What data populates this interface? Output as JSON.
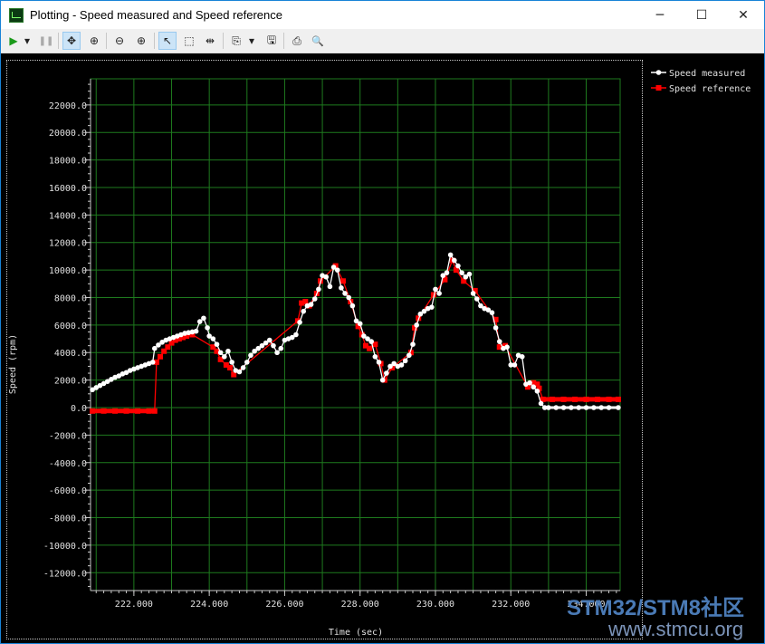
{
  "window": {
    "title": "Plotting  - Speed measured and Speed reference",
    "minimize_glyph": "─",
    "maximize_glyph": "☐",
    "close_glyph": "✕"
  },
  "toolbar": {
    "items": [
      {
        "name": "play-icon",
        "glyph": "▶"
      },
      {
        "name": "play-dropdown-icon",
        "glyph": "▾"
      },
      {
        "name": "pause-icon",
        "glyph": "❚❚"
      },
      {
        "name": "pan-icon",
        "glyph": "✥"
      },
      {
        "name": "zoom-fit-icon",
        "glyph": "⊕"
      },
      {
        "name": "zoom-out-icon",
        "glyph": "⊖"
      },
      {
        "name": "zoom-in-icon",
        "glyph": "⊕"
      },
      {
        "name": "select-pointer-icon",
        "glyph": "↖"
      },
      {
        "name": "select-rectangle-icon",
        "glyph": "⬚"
      },
      {
        "name": "cursor-marker-icon",
        "glyph": "⇹"
      },
      {
        "name": "copy-icon",
        "glyph": "⎘"
      },
      {
        "name": "copy-dropdown-icon",
        "glyph": "▾"
      },
      {
        "name": "save-icon",
        "glyph": "🖫"
      },
      {
        "name": "print-icon",
        "glyph": "⎙"
      },
      {
        "name": "print-preview-icon",
        "glyph": "🔍"
      }
    ]
  },
  "chart_data": {
    "type": "line",
    "title": "",
    "xlabel": "Time (sec)",
    "ylabel": "Speed (rpm)",
    "xlim": [
      220.85,
      234.9
    ],
    "ylim": [
      -13300,
      23900
    ],
    "grid": true,
    "legend_position": "top-right (outside plot)",
    "x_ticks": [
      "222.000",
      "224.000",
      "226.000",
      "228.000",
      "230.000",
      "232.000",
      "234.000"
    ],
    "x_tick_values": [
      222,
      224,
      226,
      228,
      230,
      232,
      234
    ],
    "y_ticks": [
      "22000.0",
      "20000.0",
      "18000.0",
      "16000.0",
      "14000.0",
      "12000.0",
      "10000.0",
      "8000.0",
      "6000.0",
      "4000.0",
      "2000.0",
      "0.0",
      "-2000.0",
      "-4000.0",
      "-6000.0",
      "-8000.0",
      "-10000.0",
      "-12000.0"
    ],
    "y_tick_values": [
      22000,
      20000,
      18000,
      16000,
      14000,
      12000,
      10000,
      8000,
      6000,
      4000,
      2000,
      0,
      -2000,
      -4000,
      -6000,
      -8000,
      -10000,
      -12000
    ],
    "colors": {
      "background": "#000000",
      "grid": "#1e7a1e",
      "axis": "#c8c8c8",
      "text": "#e0e0e0"
    },
    "series": [
      {
        "name": "Speed measured",
        "color": "#ffffff",
        "marker": "circle",
        "points": [
          [
            220.9,
            1300
          ],
          [
            221.0,
            1450
          ],
          [
            221.1,
            1600
          ],
          [
            221.2,
            1750
          ],
          [
            221.3,
            1900
          ],
          [
            221.4,
            2050
          ],
          [
            221.5,
            2200
          ],
          [
            221.6,
            2300
          ],
          [
            221.7,
            2450
          ],
          [
            221.8,
            2550
          ],
          [
            221.9,
            2700
          ],
          [
            222.0,
            2800
          ],
          [
            222.1,
            2900
          ],
          [
            222.2,
            3000
          ],
          [
            222.3,
            3100
          ],
          [
            222.4,
            3200
          ],
          [
            222.5,
            3300
          ],
          [
            222.55,
            4300
          ],
          [
            222.65,
            4550
          ],
          [
            222.75,
            4750
          ],
          [
            222.85,
            4900
          ],
          [
            222.95,
            5000
          ],
          [
            223.05,
            5100
          ],
          [
            223.15,
            5200
          ],
          [
            223.25,
            5300
          ],
          [
            223.35,
            5400
          ],
          [
            223.45,
            5450
          ],
          [
            223.55,
            5500
          ],
          [
            223.65,
            5550
          ],
          [
            223.75,
            6250
          ],
          [
            223.85,
            6500
          ],
          [
            223.95,
            5800
          ],
          [
            224.0,
            5200
          ],
          [
            224.1,
            5000
          ],
          [
            224.2,
            4600
          ],
          [
            224.3,
            4000
          ],
          [
            224.4,
            3700
          ],
          [
            224.5,
            4100
          ],
          [
            224.6,
            3300
          ],
          [
            224.7,
            2700
          ],
          [
            224.8,
            2600
          ],
          [
            224.9,
            2900
          ],
          [
            225.0,
            3300
          ],
          [
            225.1,
            3800
          ],
          [
            225.2,
            4100
          ],
          [
            225.3,
            4300
          ],
          [
            225.4,
            4500
          ],
          [
            225.5,
            4700
          ],
          [
            225.6,
            4900
          ],
          [
            225.7,
            4500
          ],
          [
            225.8,
            4000
          ],
          [
            225.9,
            4300
          ],
          [
            226.0,
            4900
          ],
          [
            226.1,
            5000
          ],
          [
            226.2,
            5100
          ],
          [
            226.3,
            5300
          ],
          [
            226.4,
            6200
          ],
          [
            226.5,
            7000
          ],
          [
            226.6,
            7400
          ],
          [
            226.7,
            7500
          ],
          [
            226.8,
            7900
          ],
          [
            226.9,
            8600
          ],
          [
            227.0,
            9600
          ],
          [
            227.1,
            9500
          ],
          [
            227.2,
            8800
          ],
          [
            227.3,
            10200
          ],
          [
            227.4,
            10000
          ],
          [
            227.5,
            8700
          ],
          [
            227.6,
            8300
          ],
          [
            227.7,
            8000
          ],
          [
            227.8,
            7400
          ],
          [
            227.9,
            6300
          ],
          [
            228.0,
            6100
          ],
          [
            228.1,
            5200
          ],
          [
            228.2,
            5000
          ],
          [
            228.3,
            4800
          ],
          [
            228.4,
            3700
          ],
          [
            228.5,
            3300
          ],
          [
            228.6,
            2000
          ],
          [
            228.7,
            2500
          ],
          [
            228.8,
            3000
          ],
          [
            228.9,
            3200
          ],
          [
            229.0,
            3000
          ],
          [
            229.1,
            3100
          ],
          [
            229.2,
            3400
          ],
          [
            229.3,
            3800
          ],
          [
            229.4,
            4600
          ],
          [
            229.5,
            6000
          ],
          [
            229.6,
            6800
          ],
          [
            229.7,
            7000
          ],
          [
            229.8,
            7200
          ],
          [
            229.9,
            7300
          ],
          [
            230.0,
            8600
          ],
          [
            230.1,
            8300
          ],
          [
            230.2,
            9600
          ],
          [
            230.3,
            9800
          ],
          [
            230.4,
            11100
          ],
          [
            230.5,
            10700
          ],
          [
            230.6,
            10300
          ],
          [
            230.7,
            9800
          ],
          [
            230.8,
            9500
          ],
          [
            230.9,
            9700
          ],
          [
            231.0,
            8300
          ],
          [
            231.1,
            7900
          ],
          [
            231.2,
            7400
          ],
          [
            231.3,
            7200
          ],
          [
            231.4,
            7100
          ],
          [
            231.5,
            6900
          ],
          [
            231.6,
            5800
          ],
          [
            231.7,
            4800
          ],
          [
            231.8,
            4300
          ],
          [
            231.9,
            4400
          ],
          [
            232.0,
            3100
          ],
          [
            232.1,
            3100
          ],
          [
            232.2,
            3800
          ],
          [
            232.3,
            3700
          ],
          [
            232.4,
            1700
          ],
          [
            232.5,
            1800
          ],
          [
            232.6,
            1500
          ],
          [
            232.7,
            1200
          ],
          [
            232.8,
            300
          ],
          [
            232.9,
            0
          ],
          [
            233.0,
            0
          ],
          [
            233.2,
            0
          ],
          [
            233.4,
            0
          ],
          [
            233.6,
            0
          ],
          [
            233.8,
            0
          ],
          [
            234.0,
            0
          ],
          [
            234.2,
            0
          ],
          [
            234.4,
            0
          ],
          [
            234.6,
            0
          ],
          [
            234.85,
            0
          ]
        ]
      },
      {
        "name": "Speed reference",
        "color": "#ff0000",
        "marker": "square",
        "points": [
          [
            220.9,
            -250
          ],
          [
            221.2,
            -250
          ],
          [
            221.5,
            -250
          ],
          [
            221.8,
            -250
          ],
          [
            222.1,
            -250
          ],
          [
            222.4,
            -250
          ],
          [
            222.55,
            -250
          ],
          [
            222.6,
            3300
          ],
          [
            222.7,
            3700
          ],
          [
            222.8,
            4100
          ],
          [
            222.9,
            4400
          ],
          [
            223.0,
            4700
          ],
          [
            223.1,
            4900
          ],
          [
            223.2,
            5000
          ],
          [
            223.3,
            5100
          ],
          [
            223.4,
            5200
          ],
          [
            223.55,
            5300
          ],
          [
            224.1,
            4400
          ],
          [
            224.2,
            4100
          ],
          [
            224.3,
            3500
          ],
          [
            224.45,
            3100
          ],
          [
            224.55,
            2900
          ],
          [
            224.65,
            2400
          ],
          [
            226.35,
            6300
          ],
          [
            226.45,
            7600
          ],
          [
            226.55,
            7700
          ],
          [
            226.65,
            7400
          ],
          [
            226.85,
            8300
          ],
          [
            226.95,
            9200
          ],
          [
            227.35,
            10300
          ],
          [
            227.55,
            9200
          ],
          [
            227.75,
            7700
          ],
          [
            227.95,
            5900
          ],
          [
            228.05,
            5300
          ],
          [
            228.15,
            4500
          ],
          [
            228.25,
            4300
          ],
          [
            228.4,
            4600
          ],
          [
            228.55,
            3200
          ],
          [
            228.65,
            2000
          ],
          [
            228.85,
            2900
          ],
          [
            229.35,
            4000
          ],
          [
            229.45,
            5800
          ],
          [
            229.55,
            6500
          ],
          [
            229.95,
            8200
          ],
          [
            230.25,
            9300
          ],
          [
            230.45,
            10700
          ],
          [
            230.55,
            10000
          ],
          [
            230.75,
            9200
          ],
          [
            231.05,
            8500
          ],
          [
            231.6,
            6400
          ],
          [
            231.7,
            4400
          ],
          [
            231.85,
            4500
          ],
          [
            232.45,
            1500
          ],
          [
            232.6,
            1800
          ],
          [
            232.7,
            1700
          ],
          [
            232.75,
            1400
          ],
          [
            232.85,
            600
          ],
          [
            233.1,
            600
          ],
          [
            233.4,
            600
          ],
          [
            233.7,
            600
          ],
          [
            234.0,
            600
          ],
          [
            234.3,
            600
          ],
          [
            234.6,
            600
          ],
          [
            234.85,
            600
          ]
        ]
      }
    ]
  },
  "watermark": {
    "line1": "STM32/STM8社区",
    "line2": "www.stmcu.org"
  }
}
